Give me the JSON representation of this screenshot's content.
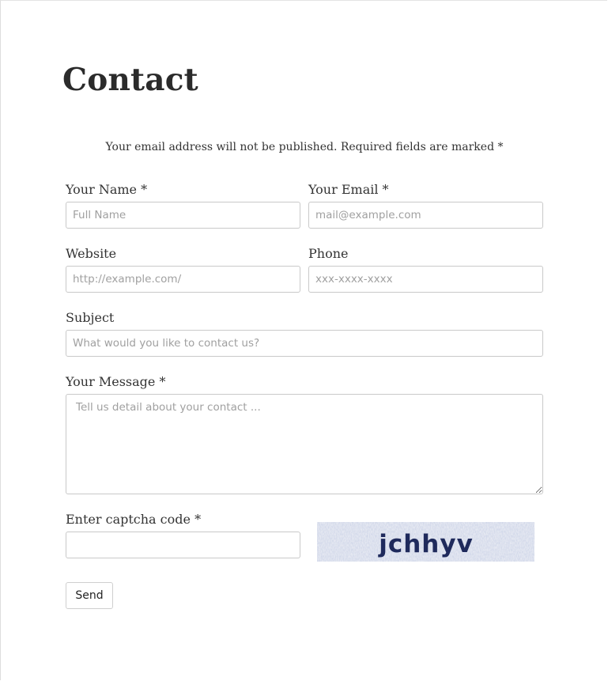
{
  "page": {
    "title": "Contact",
    "notice": "Your email address will not be published. Required fields are marked *"
  },
  "form": {
    "name": {
      "label": "Your Name *",
      "placeholder": "Full Name",
      "value": ""
    },
    "email": {
      "label": "Your Email *",
      "placeholder": "mail@example.com",
      "value": ""
    },
    "website": {
      "label": "Website",
      "placeholder": "http://example.com/",
      "value": ""
    },
    "phone": {
      "label": "Phone",
      "placeholder": "xxx-xxxx-xxxx",
      "value": ""
    },
    "subject": {
      "label": "Subject",
      "placeholder": "What would you like to contact us?",
      "value": ""
    },
    "message": {
      "label": "Your Message *",
      "placeholder": "Tell us detail about your contact ...",
      "value": ""
    },
    "captcha": {
      "label": "Enter captcha code *",
      "value": "",
      "image_text": "jchhyv"
    },
    "send_label": "Send"
  },
  "colors": {
    "text": "#333333",
    "border": "#c9c9c9",
    "captcha_text": "#1f2a5c",
    "captcha_noise": "#9aa6c8"
  }
}
